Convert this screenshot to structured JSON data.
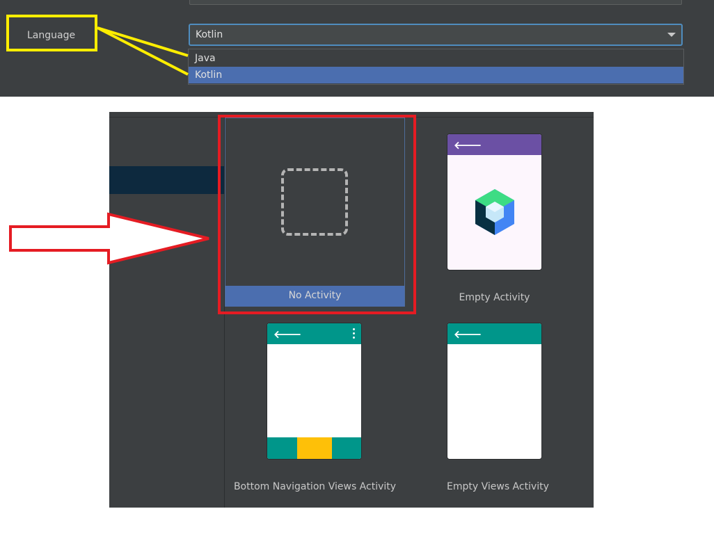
{
  "settings": {
    "language_label": "Language",
    "language_select": {
      "value": "Kotlin",
      "options": [
        "Java",
        "Kotlin"
      ],
      "selected_option": "Kotlin"
    }
  },
  "templates": {
    "cards": [
      {
        "label": "No Activity",
        "selected": true
      },
      {
        "label": "Empty Activity",
        "selected": false
      },
      {
        "label": "Bottom Navigation Views Activity",
        "selected": false
      },
      {
        "label": "Empty Views Activity",
        "selected": false
      }
    ]
  },
  "annotations": {
    "highlight_color_language": "#ffee00",
    "highlight_color_template": "#e51c23"
  },
  "colors": {
    "panel_bg": "#3c3f41",
    "selection_blue": "#4b6eaf",
    "purple_bar": "#6b50a4",
    "teal_bar": "#00968a",
    "yellow_tab": "#fec008"
  },
  "icons": {
    "back": "left-arrow-icon",
    "overflow": "vertical-dots-icon",
    "dropdown": "chevron-down-icon",
    "empty": "dashed-square-icon",
    "compose": "jetpack-compose-icon"
  }
}
